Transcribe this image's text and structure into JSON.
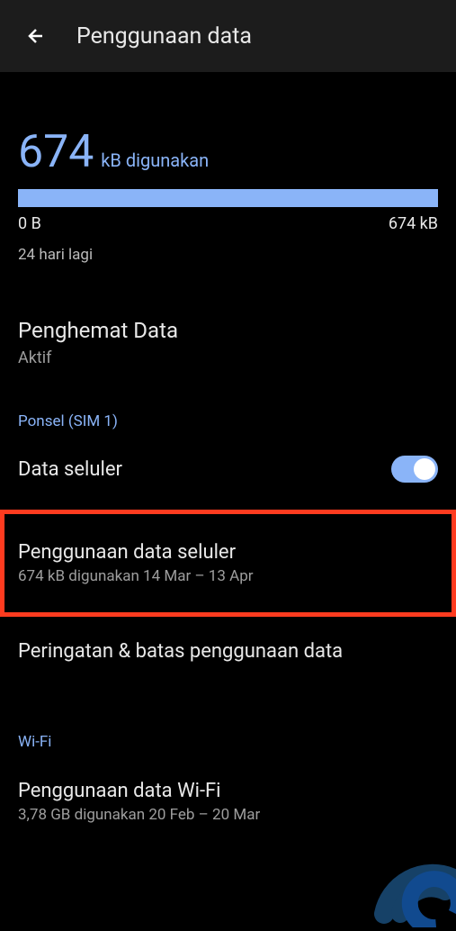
{
  "header": {
    "title": "Penggunaan data"
  },
  "usage": {
    "amount": "674",
    "unit": "kB digunakan",
    "min_label": "0 B",
    "max_label": "674 kB",
    "days_left": "24 hari lagi"
  },
  "data_saver": {
    "title": "Penghemat Data",
    "status": "Aktif"
  },
  "cellular": {
    "section_header": "Ponsel (SIM 1)",
    "toggle_label": "Data seluler",
    "usage_title": "Penggunaan data seluler",
    "usage_subtitle": "674 kB digunakan 14 Mar – 13 Apr",
    "warning_title": "Peringatan & batas penggunaan data"
  },
  "wifi": {
    "section_header": "Wi-Fi",
    "usage_title": "Penggunaan data Wi-Fi",
    "usage_subtitle": "3,78 GB digunakan 20 Feb – 20 Mar"
  }
}
